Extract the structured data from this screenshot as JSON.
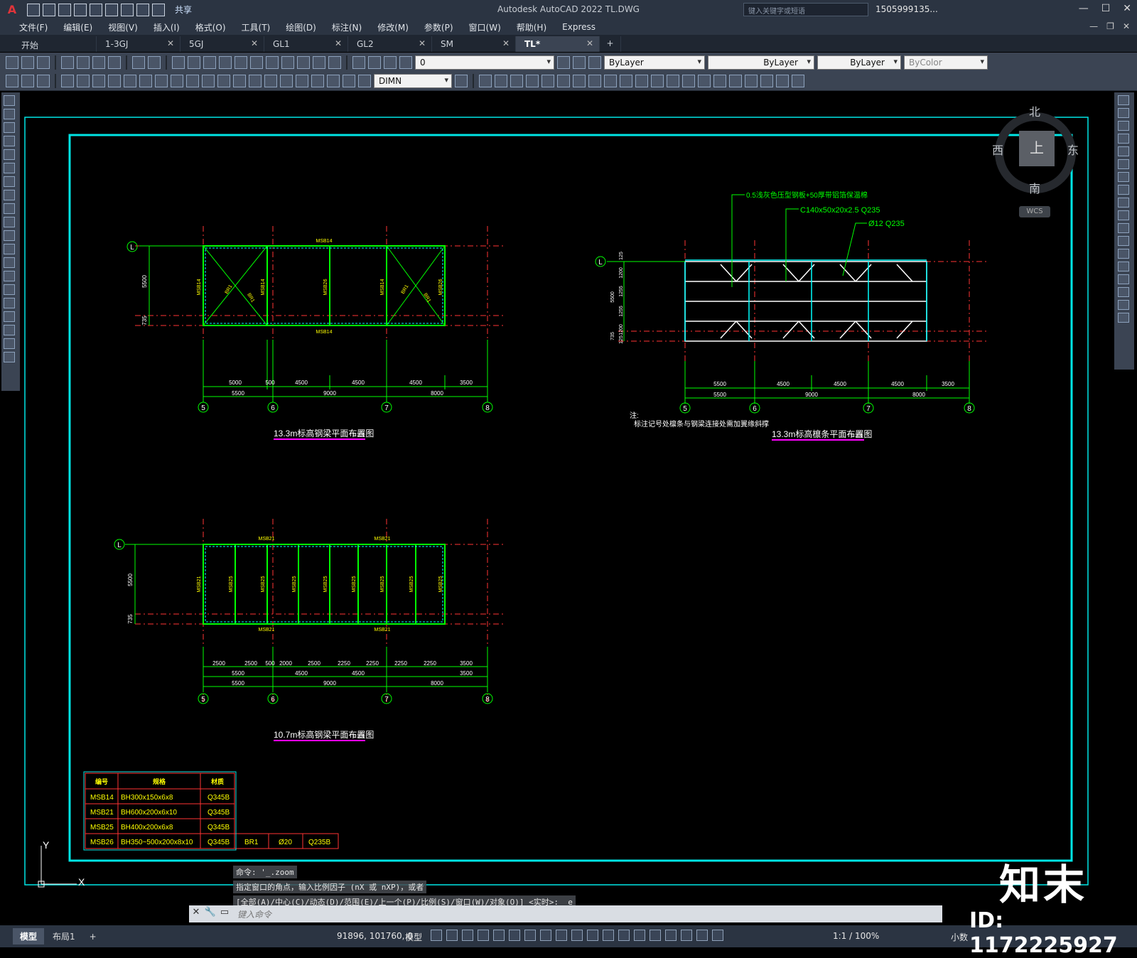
{
  "app": {
    "title": "Autodesk AutoCAD 2022    TL.DWG",
    "share_label": "共享",
    "search_placeholder": "键入关键字或短语",
    "user": "1505999135...",
    "logo_letter": "A"
  },
  "menu": [
    "文件(F)",
    "编辑(E)",
    "视图(V)",
    "插入(I)",
    "格式(O)",
    "工具(T)",
    "绘图(D)",
    "标注(N)",
    "修改(M)",
    "参数(P)",
    "窗口(W)",
    "帮助(H)",
    "Express"
  ],
  "tabs": [
    {
      "label": "开始",
      "close": false
    },
    {
      "label": "1-3GJ",
      "close": true
    },
    {
      "label": "5GJ",
      "close": true
    },
    {
      "label": "GL1",
      "close": true
    },
    {
      "label": "GL2",
      "close": true
    },
    {
      "label": "SM",
      "close": true
    },
    {
      "label": "TL*",
      "close": true,
      "active": true
    }
  ],
  "toolbar": {
    "layer_value": "0",
    "color_value": "ByLayer",
    "linetype_value": "ByLayer",
    "lineweight_value": "ByLayer",
    "plotstyle_value": "ByColor",
    "dimstyle_value": "DIMN"
  },
  "viewcube": {
    "north": "北",
    "south": "南",
    "east": "东",
    "west": "西",
    "face": "上",
    "wcs": "WCS"
  },
  "drawing": {
    "plan1": {
      "title": "13.3m标高钢梁平面布置图",
      "scale": "1:100",
      "axis_row": "L",
      "axes": [
        "5",
        "6",
        "7",
        "8"
      ],
      "beam_top": "MSB14",
      "beam_bottom": "MSB14",
      "vert_labels": [
        "MSB14",
        "MSB14",
        "MSB26",
        "MSB14",
        "MSB26"
      ],
      "brace_label": "BR1",
      "left_dims": [
        "5500",
        "735"
      ],
      "dim_row1": [
        "5000",
        "500",
        "4500",
        "4500",
        "4500",
        "3500"
      ],
      "dim_row2": [
        "5500",
        "9000",
        "8000"
      ]
    },
    "plan2": {
      "title": "13.3m标高檩条平面布置图",
      "scale": "1:100",
      "axis_row": "L",
      "axes": [
        "5",
        "6",
        "7",
        "8"
      ],
      "callouts": [
        "0.5浅灰色压型钢板+50厚带铝箔保温棉",
        "C140x50x20x2.5 Q235",
        "Ø12 Q235"
      ],
      "left_dims": [
        "5500",
        "735",
        "1200",
        "1255",
        "1255",
        "1200",
        "125",
        "125"
      ],
      "dim_row1": [
        "5500",
        "4500",
        "4500",
        "4500",
        "3500"
      ],
      "dim_row2": [
        "5500",
        "9000",
        "8000"
      ],
      "note_title": "注:",
      "note_text": "标注记号处檩条与钢梁连接处需加翼缘斜撑"
    },
    "plan3": {
      "title": "10.7m标高钢梁平面布置图",
      "scale": "1:100",
      "axis_row": "L",
      "axes": [
        "5",
        "6",
        "7",
        "8"
      ],
      "beam_top": "MSB21",
      "beam_bottom": "MSB21",
      "vert_labels": [
        "MSB21",
        "MSB25",
        "MSB25",
        "MSB25",
        "MSB25",
        "MSB25",
        "MSB25",
        "MSB25",
        "MSB25"
      ],
      "left_dims": [
        "5500",
        "735"
      ],
      "dim_row1": [
        "2500",
        "2500",
        "500",
        "2000",
        "2500",
        "2250",
        "2250",
        "2250",
        "2250",
        "3500"
      ],
      "dim_row2": [
        "5500",
        "4500",
        "4500",
        "3500"
      ],
      "dim_row3": [
        "5500",
        "9000",
        "8000"
      ]
    },
    "table": {
      "headers": [
        "编号",
        "规格",
        "材质"
      ],
      "rows": [
        [
          "MSB14",
          "BH300x150x6x8",
          "Q345B"
        ],
        [
          "MSB21",
          "BH600x200x6x10",
          "Q345B"
        ],
        [
          "MSB25",
          "BH400x200x6x8",
          "Q345B"
        ],
        [
          "MSB26",
          "BH350~500x200x8x10",
          "Q345B"
        ]
      ],
      "extra": [
        "BR1",
        "Ø20",
        "Q235B"
      ]
    },
    "ucs": {
      "x": "X",
      "y": "Y"
    }
  },
  "command": {
    "history": [
      "命令: '_.zoom",
      "指定窗口的角点，输入比例因子 (nX 或 nXP)，或者",
      "[全部(A)/中心(C)/动态(D)/范围(E)/上一个(P)/比例(S)/窗口(W)/对象(O)] <实时>: _e"
    ],
    "placeholder": "键入命令"
  },
  "status": {
    "tabs": [
      "模型",
      "布局1"
    ],
    "coords": "91896, 101760, 0",
    "mode": "模型",
    "scale": "1:1 / 100%",
    "units": "小数"
  },
  "watermark": {
    "brand": "知末",
    "id": "ID: 1172225927"
  },
  "colors": {
    "frame": "#00e5e5",
    "axis": "#ff3333",
    "beam": "#00ff00",
    "label": "#ffff00",
    "text": "#ffffff",
    "title_underline": "#ff00ff"
  }
}
